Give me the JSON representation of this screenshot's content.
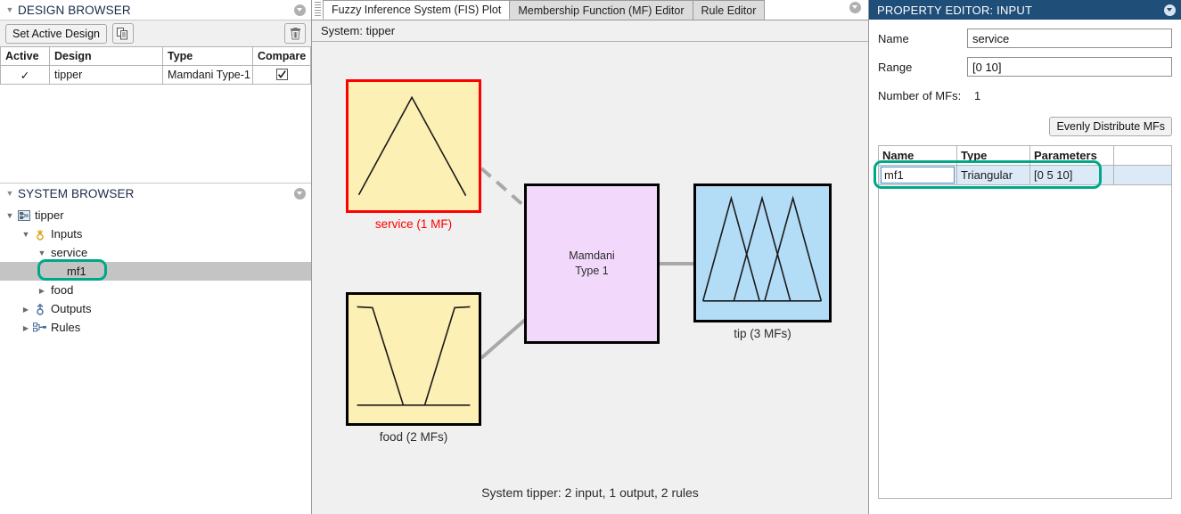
{
  "design_browser": {
    "title": "DESIGN BROWSER",
    "collapse_icon": "chevron-down-circle-icon",
    "toolbar": {
      "set_active_label": "Set Active Design",
      "duplicate_icon": "duplicate-icon",
      "delete_icon": "trash-icon"
    },
    "columns": [
      "Active",
      "Design",
      "Type",
      "Compare"
    ],
    "rows": [
      {
        "active": "✓",
        "design": "tipper",
        "type": "Mamdani Type-1",
        "compare": true
      }
    ]
  },
  "system_browser": {
    "title": "SYSTEM BROWSER",
    "collapse_icon": "chevron-down-circle-icon",
    "nodes": [
      {
        "label": "tipper",
        "indent": 0,
        "twisty": "open",
        "icon": "fis-icon",
        "selected": false
      },
      {
        "label": "Inputs",
        "indent": 1,
        "twisty": "open",
        "icon": "input-icon",
        "selected": false
      },
      {
        "label": "service",
        "indent": 2,
        "twisty": "open",
        "icon": "none",
        "selected": false
      },
      {
        "label": "mf1",
        "indent": 3,
        "twisty": "none",
        "icon": "none",
        "selected": true
      },
      {
        "label": "food",
        "indent": 2,
        "twisty": "closed",
        "icon": "none",
        "selected": false
      },
      {
        "label": "Outputs",
        "indent": 1,
        "twisty": "closed",
        "icon": "output-icon",
        "selected": false
      },
      {
        "label": "Rules",
        "indent": 1,
        "twisty": "closed",
        "icon": "rules-icon",
        "selected": false
      }
    ]
  },
  "center": {
    "tabs": [
      {
        "label": "Fuzzy Inference System (FIS) Plot",
        "active": true
      },
      {
        "label": "Membership Function (MF) Editor",
        "active": false
      },
      {
        "label": "Rule Editor",
        "active": false
      }
    ],
    "collapse_icon": "chevron-down-circle-icon",
    "system_line": "System: tipper",
    "blocks": {
      "service": {
        "caption": "service (1 MF)",
        "selected": true
      },
      "food": {
        "caption": "food (2 MFs)",
        "selected": false
      },
      "engine": {
        "line1": "Mamdani",
        "line2": "Type 1"
      },
      "tip": {
        "caption": "tip (3 MFs)",
        "selected": false
      }
    },
    "footer": "System tipper: 2 input, 1 output, 2 rules"
  },
  "property_editor": {
    "title": "PROPERTY EDITOR: INPUT",
    "collapse_icon": "chevron-down-circle-icon",
    "name_label": "Name",
    "name_value": "service",
    "range_label": "Range",
    "range_value": "[0 10]",
    "mf_count_label": "Number of MFs:",
    "mf_count_value": "1",
    "evenly_distribute_label": "Evenly Distribute MFs",
    "columns": [
      "Name",
      "Type",
      "Parameters"
    ],
    "rows": [
      {
        "name": "mf1",
        "type": "Triangular",
        "parameters": "[0 5 10]",
        "selected": true
      }
    ]
  },
  "colors": {
    "header_navy": "#1f4e79",
    "input_block": "#fdf0b5",
    "engine_block": "#f2d9fb",
    "output_block": "#b3dcf7",
    "selection_red": "#ff0000",
    "highlight_teal": "#00a887",
    "row_select_blue": "#dceaf7"
  }
}
